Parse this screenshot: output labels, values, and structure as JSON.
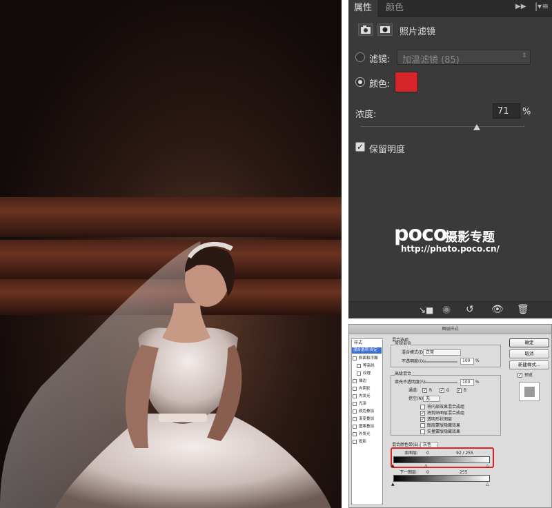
{
  "photo": {
    "alt": "bride"
  },
  "properties": {
    "tabs": [
      "属性",
      "颜色"
    ],
    "header_label": "照片滤镜",
    "filter_label": "滤镜:",
    "filter_value": "加温滤镜 (85)",
    "color_label": "颜色:",
    "color_value": "#d8252a",
    "density_label": "浓度:",
    "density_value": "71",
    "density_unit": "%",
    "density_fraction": 0.71,
    "preserve_label": "保留明度",
    "watermark_brand": "poco",
    "watermark_title": "摄影专题",
    "watermark_url": "http://photo.poco.cn/"
  },
  "dialog": {
    "title": "图层样式",
    "sidebar_title": "样式",
    "sidebar_items": [
      "混合选项:自定",
      "斜面和浮雕",
      "等高线",
      "纹理",
      "描边",
      "内阴影",
      "内发光",
      "光泽",
      "颜色叠加",
      "渐变叠加",
      "图案叠加",
      "外发光",
      "投影"
    ],
    "blend_section": "混合选项",
    "general_blend": "常规混合",
    "blend_mode_label": "混合模式(D):",
    "blend_mode_value": "正常",
    "opacity_label": "不透明度(O):",
    "opacity_value": "100",
    "pct": "%",
    "advanced_blend": "高级混合",
    "fill_opacity_label": "填充不透明度(F):",
    "fill_opacity_value": "100",
    "channels_label": "通道:",
    "channel_r": "R",
    "channel_g": "G",
    "channel_b": "B",
    "knockout_label": "挖空(N):",
    "knockout_value": "无",
    "options": [
      "将内部效果混合成组",
      "将剪贴图层混合成组",
      "透明形状图层",
      "图层蒙版隐藏效果",
      "矢量蒙版隐藏效果"
    ],
    "blend_if_label": "混合颜色带(E):",
    "blend_if_value": "灰色",
    "this_layer_label": "本图层:",
    "this_layer_low": "0",
    "this_layer_high": "92 / 255",
    "underlying_label": "下一图层:",
    "underlying_low": "0",
    "underlying_high": "255",
    "ok": "确定",
    "cancel": "取消",
    "new_style": "新建样式...",
    "preview": "预览"
  },
  "colors": {
    "panel_bg": "#3a3a3a",
    "highlight_red": "#e02020"
  }
}
